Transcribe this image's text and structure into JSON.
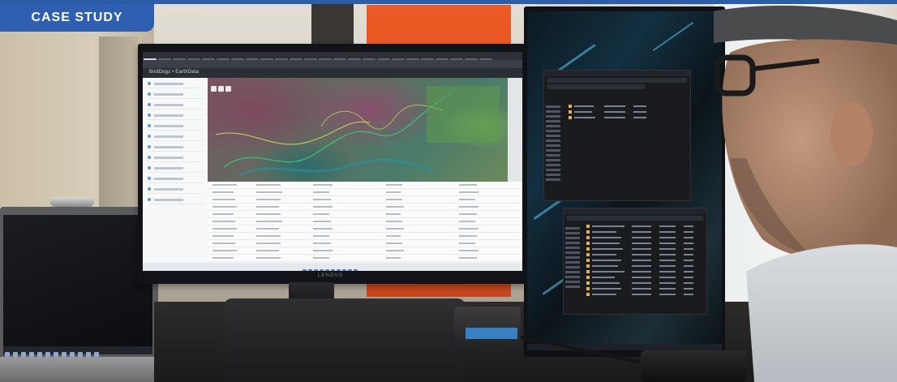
{
  "badge": {
    "label": "CASE STUDY",
    "color": "#2f5fb0"
  },
  "scene": {
    "main_monitor": {
      "brand": "LENOVO",
      "app_name": "BirdDogs • EarthData",
      "content": "map viewer with satellite imagery and attribute table"
    },
    "vertical_monitor": {
      "content": "two file explorer windows"
    },
    "colors": {
      "accent_orange": "#ea5a25",
      "top_rule": "#2b5da8"
    }
  }
}
